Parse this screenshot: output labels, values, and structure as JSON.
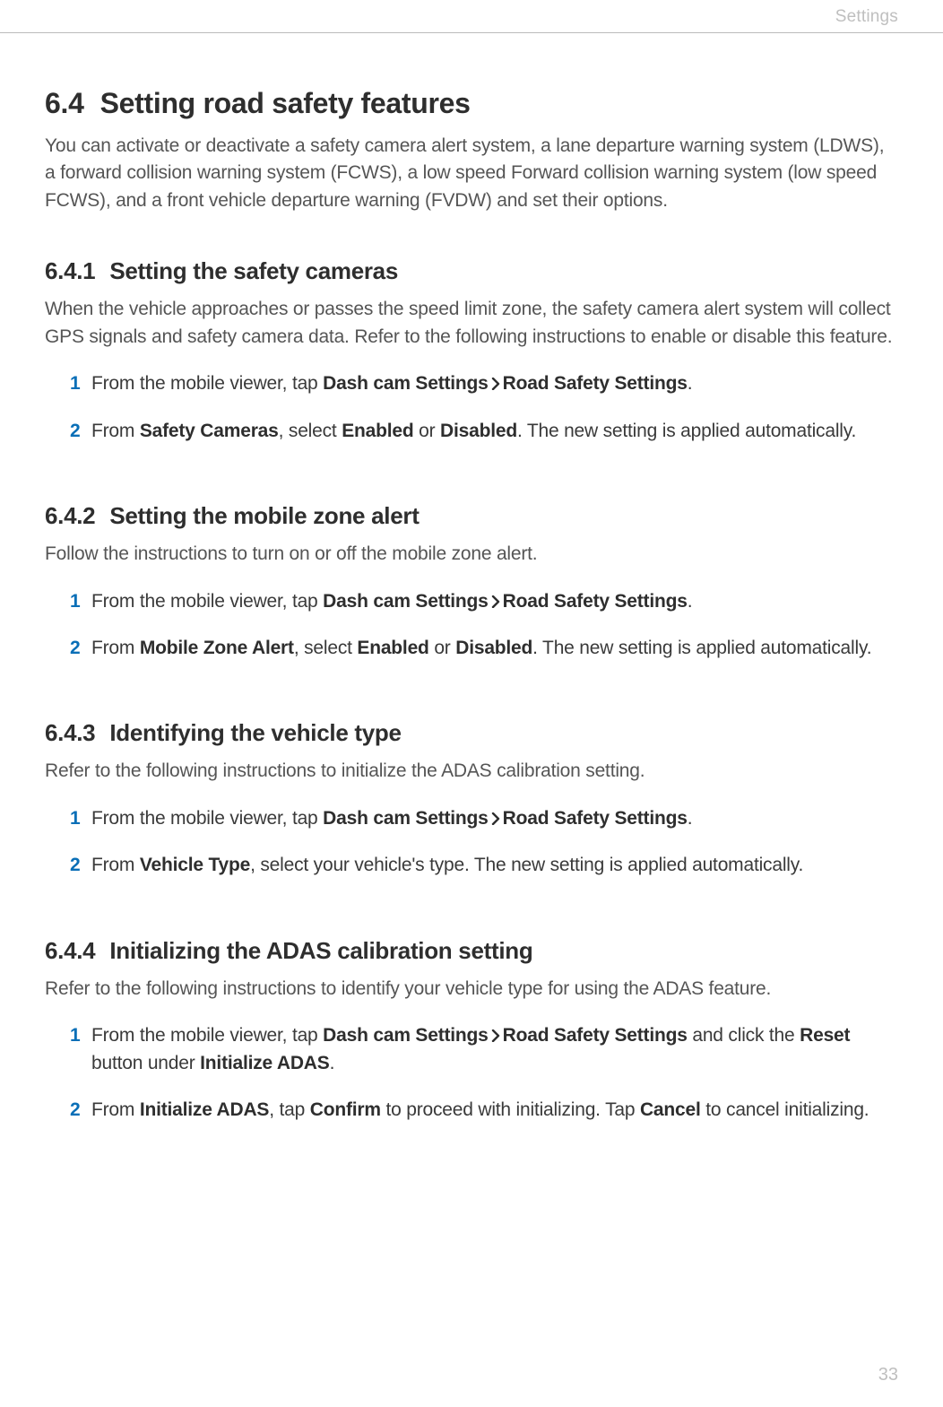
{
  "header": {
    "label": "Settings"
  },
  "page_number": "33",
  "section": {
    "number": "6.4",
    "title": "Setting road safety features",
    "intro": "You can activate or deactivate a safety camera alert system, a lane departure warning system (LDWS), a forward collision warning system (FCWS), a low speed Forward collision warning system (low speed FCWS), and a front vehicle departure warning (FVDW) and set their options."
  },
  "subs": [
    {
      "number": "6.4.1",
      "title": "Setting the safety cameras",
      "intro": "When the vehicle approaches or passes the speed limit zone, the safety camera alert system will collect GPS signals and safety camera data. Refer to the following instructions to enable or disable this feature.",
      "steps": [
        {
          "num": "1",
          "pre": "From the mobile viewer, tap ",
          "b1": "Dash cam Settings",
          "chev": true,
          "b2": "Road Safety Settings",
          "post": "."
        },
        {
          "num": "2",
          "raw_pre": "From ",
          "raw_b1": "Safety Cameras",
          "raw_mid1": ", select ",
          "raw_b2": "Enabled",
          "raw_mid2": " or ",
          "raw_b3": "Disabled",
          "raw_post": ". The new setting is applied automatically."
        }
      ]
    },
    {
      "number": "6.4.2",
      "title": "Setting the mobile zone alert",
      "intro": "Follow the instructions to turn on or off the mobile zone alert.",
      "steps": [
        {
          "num": "1",
          "pre": "From the mobile viewer, tap ",
          "b1": "Dash cam Settings",
          "chev": true,
          "b2": "Road Safety Settings",
          "post": "."
        },
        {
          "num": "2",
          "raw_pre": "From ",
          "raw_b1": "Mobile Zone Alert",
          "raw_mid1": ", select ",
          "raw_b2": "Enabled",
          "raw_mid2": " or ",
          "raw_b3": "Disabled",
          "raw_post": ". The new setting is applied automatically."
        }
      ]
    },
    {
      "number": "6.4.3",
      "title": "Identifying the vehicle type",
      "intro": "Refer to the following instructions to initialize the ADAS calibration setting.",
      "steps": [
        {
          "num": "1",
          "pre": "From the mobile viewer, tap ",
          "b1": "Dash cam Settings",
          "chev": true,
          "b2": "Road Safety Settings",
          "post": "."
        },
        {
          "num": "2",
          "raw_pre": "From ",
          "raw_b1": "Vehicle Type",
          "raw_mid1": ", select your vehicle's type. The new setting is applied automatically.",
          "raw_b2": "",
          "raw_mid2": "",
          "raw_b3": "",
          "raw_post": ""
        }
      ]
    },
    {
      "number": "6.4.4",
      "title": "Initializing the ADAS calibration setting",
      "intro": "Refer to the following instructions to identify your vehicle type for using the ADAS feature.",
      "steps": [
        {
          "num": "1",
          "pre": "From the mobile viewer, tap ",
          "b1": "Dash cam Settings",
          "chev": true,
          "b2": "Road Safety Settings",
          "post_b": " and click the ",
          "b3": "Reset",
          "post_b2": " button under ",
          "b4": "Initialize ADAS",
          "final": "."
        },
        {
          "num": "2",
          "raw_pre": "From ",
          "raw_b1": "Initialize ADAS",
          "raw_mid1": ", tap ",
          "raw_b2": "Confirm",
          "raw_mid2": " to proceed with initializing. Tap ",
          "raw_b3": "Cancel",
          "raw_post": " to cancel initializing."
        }
      ]
    }
  ]
}
